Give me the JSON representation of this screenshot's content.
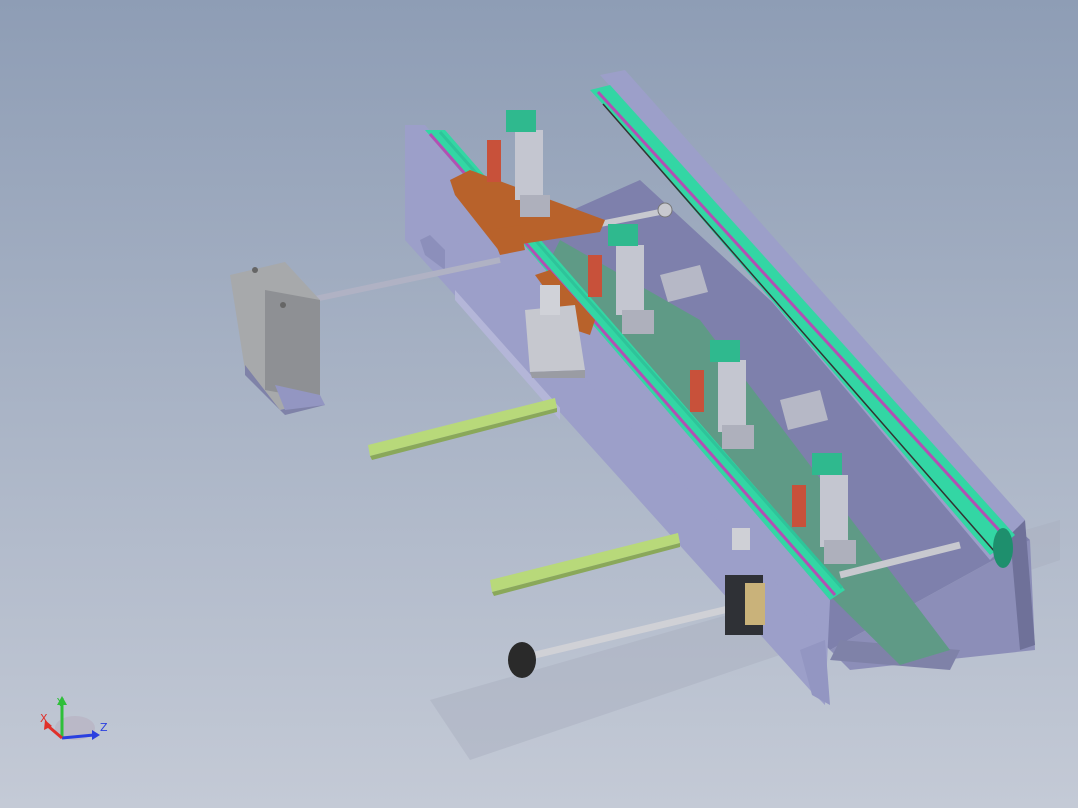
{
  "viewport": {
    "background_top": "#8e9db5",
    "background_bottom": "#c4cad6"
  },
  "model": {
    "frame_color": "#9c9fc9",
    "frame_dark": "#6f7199",
    "belt_color": "#33d6a4",
    "belt_edge_color": "#b34fb3",
    "carriage_color": "#b8622b",
    "cylinder_color": "#c8513a",
    "sensor_color": "#2fb98e",
    "rail_color": "#b8d97a",
    "motor_color": "#a7a9ab",
    "plate_color": "#5f9a86",
    "knob_color": "#2a2a2a"
  },
  "triad": {
    "x_label": "X",
    "y_label": "Y",
    "z_label": "Z",
    "x_color": "#e0302a",
    "y_color": "#2fbf3a",
    "z_color": "#2a3fe0"
  }
}
